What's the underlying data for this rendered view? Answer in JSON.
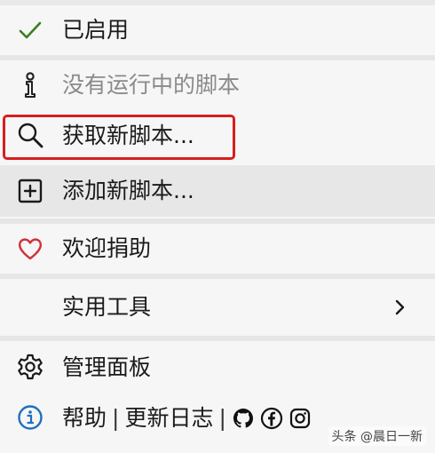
{
  "menu": {
    "enabled_label": "已启用",
    "no_scripts_label": "没有运行中的脚本",
    "get_scripts_label": "获取新脚本...",
    "add_script_label": "添加新脚本...",
    "donate_label": "欢迎捐助",
    "utilities_label": "实用工具",
    "dashboard_label": "管理面板",
    "help_label": "帮助",
    "changelog_label": "更新日志",
    "separator": "|"
  },
  "colors": {
    "check": "#3a7d1f",
    "heart": "#d0323a",
    "info": "#1f6fc0",
    "highlight": "#d81e1e"
  },
  "icons": [
    "checkmark-icon",
    "info-icon",
    "search-icon",
    "plus-square-icon",
    "heart-icon",
    "chevron-right-icon",
    "gear-icon",
    "info-circle-icon",
    "github-icon",
    "facebook-icon",
    "instagram-icon"
  ],
  "watermark": "头条 @晨日一新"
}
